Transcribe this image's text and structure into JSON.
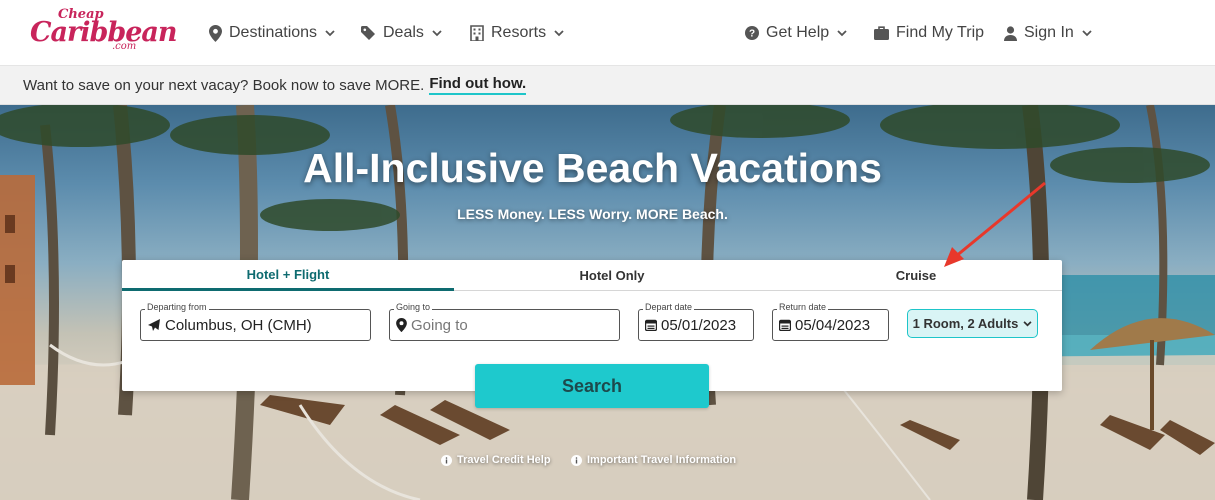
{
  "brand": {
    "logo_top": "Cheap",
    "logo_main": "Caribbean",
    "logo_suffix": ".com",
    "primary_color": "#c8245b",
    "accent_color": "#1ec9cd"
  },
  "nav": {
    "destinations": "Destinations",
    "deals": "Deals",
    "resorts": "Resorts",
    "get_help": "Get Help",
    "find_my_trip": "Find My Trip",
    "sign_in": "Sign In"
  },
  "promo": {
    "text": "Want to save on your next vacay? Book now to save MORE.",
    "link": "Find out how."
  },
  "hero": {
    "title": "All-Inclusive Beach Vacations",
    "subtitle": "LESS Money. LESS Worry. MORE Beach."
  },
  "search": {
    "tabs": [
      "Hotel + Flight",
      "Hotel Only",
      "Cruise"
    ],
    "active_tab": "Hotel + Flight",
    "departing": {
      "label": "Departing from",
      "value": "Columbus, OH (CMH)"
    },
    "going": {
      "label": "Going to",
      "placeholder": "Going to"
    },
    "depart_date": {
      "label": "Depart date",
      "value": "05/01/2023"
    },
    "return_date": {
      "label": "Return date",
      "value": "05/04/2023"
    },
    "rooms": "1 Room, 2 Adults",
    "button": "Search"
  },
  "footer_links": {
    "credit": "Travel Credit Help",
    "info": "Important Travel Information"
  },
  "annotation": {
    "arrow_color": "#e8382b"
  }
}
